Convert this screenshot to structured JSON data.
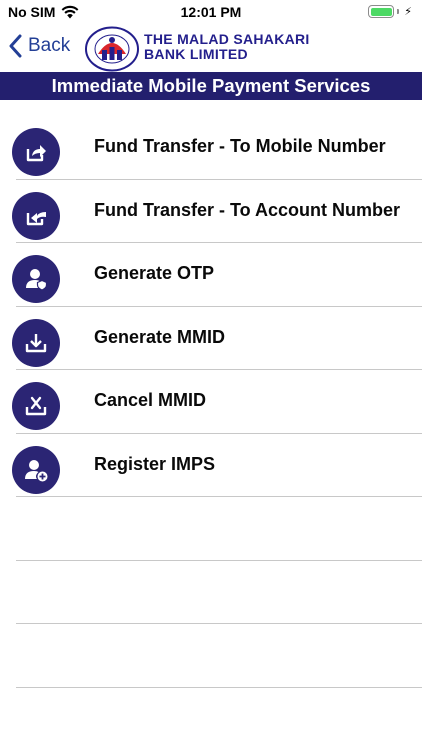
{
  "status_bar": {
    "carrier": "No SIM",
    "time": "12:01 PM",
    "charging_symbol": "⚡"
  },
  "nav": {
    "back_label": "Back",
    "bank_name_line1": "THE MALAD SAHAKARI",
    "bank_name_line2": "BANK LIMITED",
    "logo_text": "THE MALAD SAHAKARI BANK LIMITED"
  },
  "title": "Immediate Mobile Payment Services",
  "menu": {
    "items": [
      {
        "label": "Fund Transfer - To Mobile Number",
        "icon": "share-out-icon"
      },
      {
        "label": "Fund Transfer - To Account Number",
        "icon": "share-in-icon"
      },
      {
        "label": "Generate OTP",
        "icon": "user-shield-icon"
      },
      {
        "label": "Generate MMID",
        "icon": "download-tray-icon"
      },
      {
        "label": "Cancel MMID",
        "icon": "cancel-tray-icon"
      },
      {
        "label": "Register IMPS",
        "icon": "user-add-icon"
      }
    ]
  },
  "colors": {
    "primary": "#231f6e",
    "icon_bg": "#2b2574",
    "back_blue": "#233f96",
    "battery_green": "#4cd964"
  }
}
